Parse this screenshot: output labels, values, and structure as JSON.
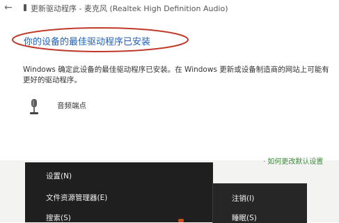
{
  "window": {
    "back_icon": "back-arrow-icon",
    "title": "更新驱动程序 - 麦克风 (Realtek High Definition Audio)"
  },
  "main": {
    "heading": "你的设备的最佳驱动程序已安装",
    "heading_color": "#1f5fb5",
    "highlight_color": "#c0392b",
    "description": "Windows 确定此设备的最佳驱动程序已安装。在 Windows 更新或设备制造商的网站上可能有更好的驱动程序。",
    "device": {
      "icon": "microphone-icon",
      "label": "音频端点"
    }
  },
  "background_window": {
    "partial_text": "· 如何更改默认设置"
  },
  "start_menu": {
    "items": [
      "设置(N)",
      "文件资源管理器(E)",
      "搜索(S)"
    ]
  },
  "shutdown_submenu": {
    "items": [
      "注销(I)",
      "睡眠(S)"
    ]
  }
}
